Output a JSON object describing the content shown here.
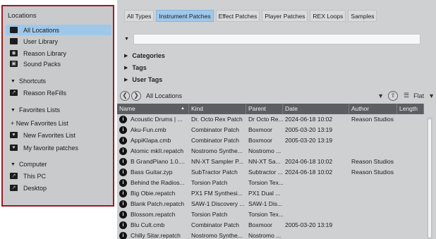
{
  "locations": {
    "title": "Locations",
    "items": [
      {
        "label": "All Locations",
        "icon": "folder-icon",
        "selected": true
      },
      {
        "label": "User Library",
        "icon": "folder-icon"
      },
      {
        "label": "Reason Library",
        "icon": "reason-library-icon"
      },
      {
        "label": "Sound Packs",
        "icon": "sound-pack-icon"
      }
    ],
    "shortcuts": {
      "label": "Shortcuts",
      "items": [
        {
          "label": "Reason ReFills",
          "icon": "refill-folder-icon"
        }
      ]
    },
    "favorites": {
      "label": "Favorites Lists",
      "new_link": "+ New Favorites List",
      "items": [
        {
          "label": "New Favorites List",
          "icon": "favorites-icon"
        },
        {
          "label": "My favorite patches",
          "icon": "favorites-icon"
        }
      ]
    },
    "computer": {
      "label": "Computer",
      "items": [
        {
          "label": "This PC",
          "icon": "pc-folder-icon"
        },
        {
          "label": "Desktop",
          "icon": "desktop-folder-icon"
        }
      ]
    }
  },
  "tabs": [
    {
      "label": "All Types",
      "active": false
    },
    {
      "label": "Instrument Patches",
      "active": true
    },
    {
      "label": "Effect Patches",
      "active": false
    },
    {
      "label": "Player Patches",
      "active": false
    },
    {
      "label": "REX Loops",
      "active": false
    },
    {
      "label": "Samples",
      "active": false
    }
  ],
  "search": {
    "value": ""
  },
  "filters": [
    "Categories",
    "Tags",
    "User Tags"
  ],
  "navigation": {
    "back_glyph": "❮",
    "forward_glyph": "❯",
    "path": "All Locations",
    "view": "Flat"
  },
  "table": {
    "columns": [
      "Name",
      "Kind",
      "Parent",
      "Date",
      "Author",
      "Length"
    ],
    "rows": [
      [
        "Acoustic Drums | ...",
        "Dr. Octo Rex Patch",
        "Dr Octo Re...",
        "2024-06-18 10:02",
        "Reason Studios",
        ""
      ],
      [
        "Aku-Fun.cmb",
        "Combinator Patch",
        "Boxmoor",
        "2005-03-20 13:19",
        "",
        ""
      ],
      [
        "AppiKlapa.cmb",
        "Combinator Patch",
        "Boxmoor",
        "2005-03-20 13:19",
        "",
        ""
      ],
      [
        "Atomic mkII.repatch",
        "Nostromo Synthe...",
        "Nostromo ...",
        "",
        "",
        ""
      ],
      [
        "B GrandPiano 1.0....",
        "NN-XT Sampler P...",
        "NN-XT Sa...",
        "2024-06-18 10:02",
        "Reason Studios",
        ""
      ],
      [
        "Bass Guitar.zyp",
        "SubTractor Patch",
        "Subtractor ...",
        "2024-06-18 10:02",
        "Reason Studios",
        ""
      ],
      [
        "Behind the Radios...",
        "Torsion Patch",
        "Torsion Tex...",
        "",
        "",
        ""
      ],
      [
        "Big Obie.repatch",
        "PX1 FM Synthesi...",
        "PX1 Dual ...",
        "",
        "",
        ""
      ],
      [
        "Blank Patch.repatch",
        "SAW-1 Discovery ...",
        "SAW-1 Dis...",
        "",
        "",
        ""
      ],
      [
        "Blossom.repatch",
        "Torsion Patch",
        "Torsion Tex...",
        "",
        "",
        ""
      ],
      [
        "Blu Cult.cmb",
        "Combinator Patch",
        "Boxmoor",
        "2005-03-20 13:19",
        "",
        ""
      ],
      [
        "Chilly Sitar.repatch",
        "Nostromo Synthe...",
        "Nostromo ...",
        "",
        "",
        ""
      ]
    ]
  },
  "colors": {
    "selection": "#9fc7ea",
    "panel_border": "#9b1c24",
    "header_bg": "#5b5e62"
  }
}
